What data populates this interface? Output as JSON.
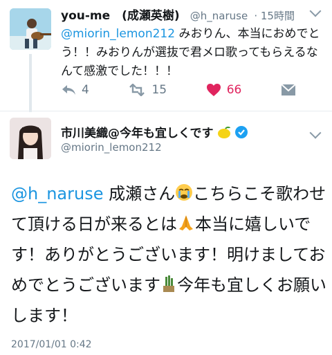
{
  "reply": {
    "display_name": "you-me　(成瀬英樹)",
    "handle": "@h_naruse",
    "timestamp": "· 15時間",
    "mention": "@miorin_lemon212",
    "text": " みおりん、本当におめでとう！！みおりんが選抜で君メロ歌ってもらえるなんて感激でした！！！",
    "reply_count": "4",
    "retweet_count": "15",
    "like_count": "66"
  },
  "main_tweet": {
    "display_name": "市川美織@今年も宜しくです",
    "handle": "@miorin_lemon212",
    "mention": "@h_naruse",
    "text_part1": " 成瀬さん",
    "text_part2": "こちらこそ歌わせて頂ける日が来るとは",
    "text_part3": "本当に嬉しいです！ありがとうございます！明けましておめでとうございます",
    "text_part4": "今年も宜しくお願いします！",
    "date": "2017/01/01 0:42"
  },
  "colors": {
    "link": "#1b95e0",
    "like": "#e0245e",
    "muted": "#657786",
    "verified": "#1da1f2"
  },
  "icons": [
    "reply-icon",
    "retweet-icon",
    "heart-icon",
    "dm-icon",
    "chevron-down-icon",
    "verified-badge-icon",
    "lemon-emoji",
    "crying-emoji",
    "praying-hands-emoji",
    "kadomatsu-emoji"
  ]
}
